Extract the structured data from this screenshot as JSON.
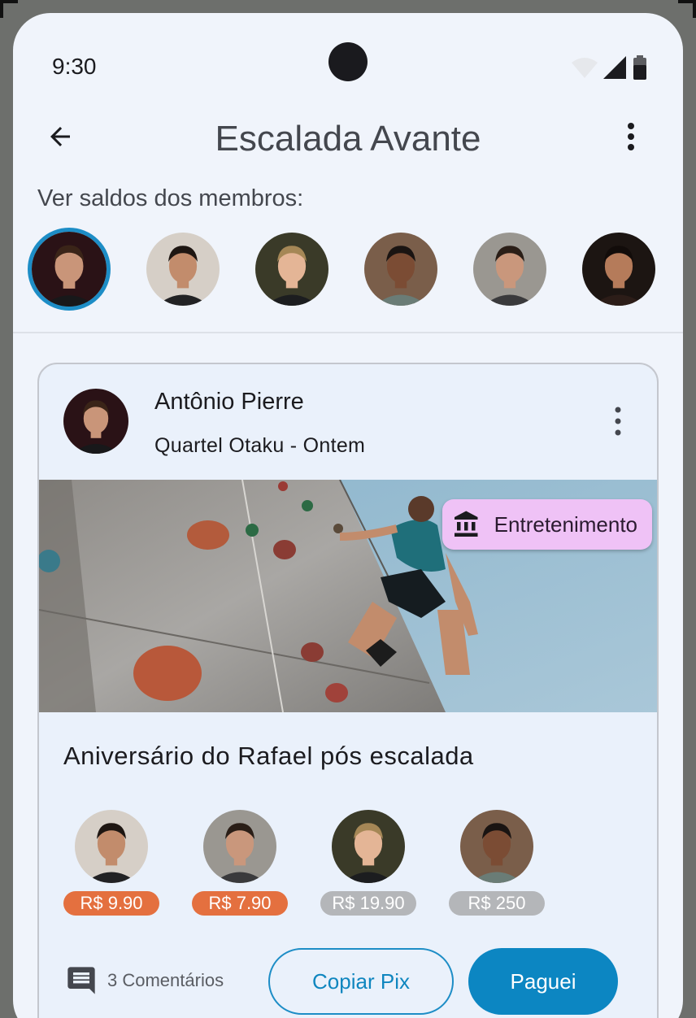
{
  "status_bar": {
    "time": "9:30"
  },
  "app_bar": {
    "title": "Escalada Avante"
  },
  "members_section": {
    "label": "Ver saldos dos membros:",
    "members": [
      {
        "name": "member-1",
        "selected": true,
        "colors": {
          "bg": "#2a1216",
          "skin": "#c99579",
          "hair": "#3a2418",
          "shirt": "#18181a"
        }
      },
      {
        "name": "member-2",
        "selected": false,
        "colors": {
          "bg": "#d6cfc7",
          "skin": "#c28c6c",
          "hair": "#1e1612",
          "shirt": "#222224"
        }
      },
      {
        "name": "member-3",
        "selected": false,
        "colors": {
          "bg": "#3a3a28",
          "skin": "#e4b596",
          "hair": "#a58756",
          "shirt": "#1c1d1f"
        }
      },
      {
        "name": "member-4",
        "selected": false,
        "colors": {
          "bg": "#7a5e4a",
          "skin": "#7b4c34",
          "hair": "#1a1412",
          "shirt": "#6a7c76"
        }
      },
      {
        "name": "member-5",
        "selected": false,
        "colors": {
          "bg": "#9a9791",
          "skin": "#c9977c",
          "hair": "#2a1e17",
          "shirt": "#3a3a3c"
        }
      },
      {
        "name": "member-6",
        "selected": false,
        "colors": {
          "bg": "#1c1512",
          "skin": "#b57b5a",
          "hair": "#120c0a",
          "shirt": "#2c1d18"
        }
      }
    ]
  },
  "card": {
    "author": "Antônio Pierre",
    "subtitle": "Quartel Otaku - Ontem",
    "category": {
      "label": "Entretenimento",
      "icon": "bank-icon",
      "color": "#efc2f6"
    },
    "description": "Aniversário do Rafael pós escalada",
    "payers": [
      {
        "amount": "R$ 9.90",
        "status": "due",
        "colors": {
          "bg": "#d6cfc7",
          "skin": "#c28c6c",
          "hair": "#1e1612",
          "shirt": "#222224"
        }
      },
      {
        "amount": "R$ 7.90",
        "status": "due",
        "colors": {
          "bg": "#9a9791",
          "skin": "#c9977c",
          "hair": "#2a1e17",
          "shirt": "#3a3a3c"
        }
      },
      {
        "amount": "R$ 19.90",
        "status": "paid",
        "colors": {
          "bg": "#3a3a28",
          "skin": "#e4b596",
          "hair": "#a58756",
          "shirt": "#1c1d1f"
        }
      },
      {
        "amount": "R$ 250",
        "status": "paid",
        "colors": {
          "bg": "#7a5e4a",
          "skin": "#7b4c34",
          "hair": "#1a1412",
          "shirt": "#6a7c76"
        }
      }
    ],
    "comments_label": "3 Comentários",
    "copy_pix_label": "Copiar Pix",
    "paid_label": "Paguei"
  },
  "colors": {
    "accent": "#0c86c2",
    "due": "#e4703f",
    "paid": "#b4b6b9",
    "background": "#f0f4fb"
  }
}
